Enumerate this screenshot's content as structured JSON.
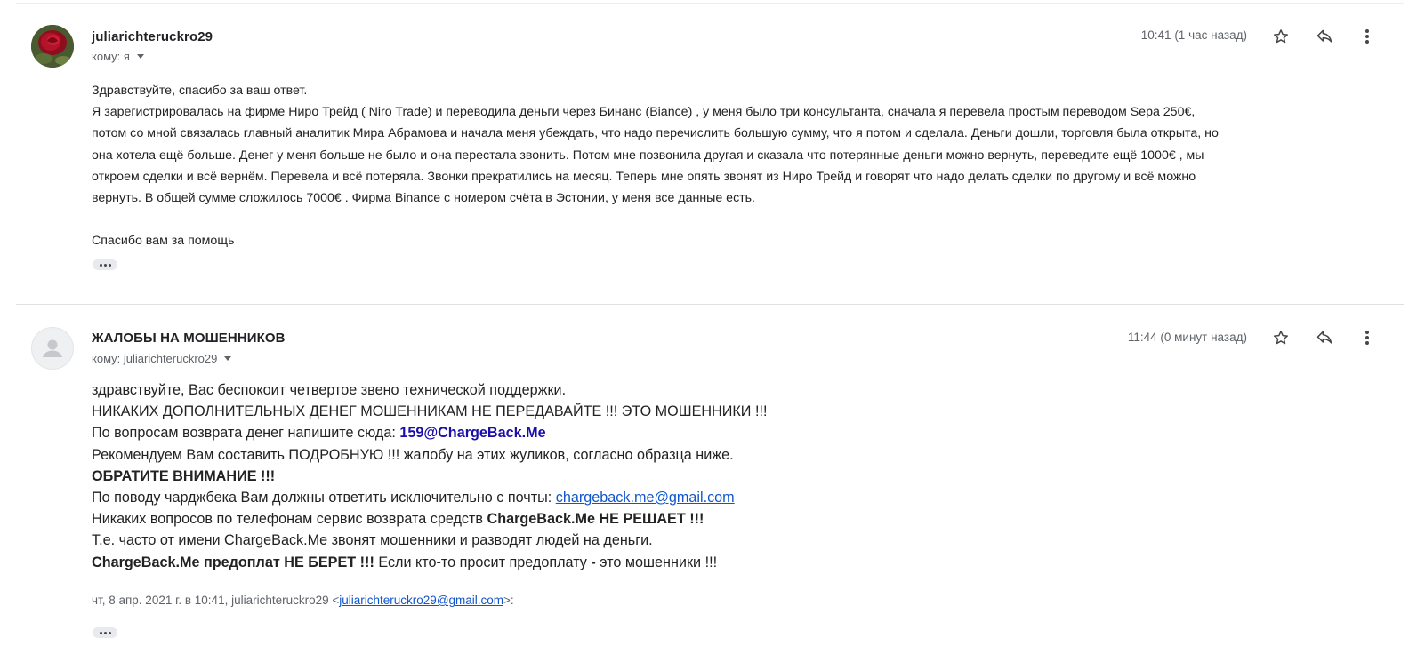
{
  "messages": [
    {
      "sender": "juliarichteruckro29",
      "recipient_line": "кому: я",
      "time": "10:41 (1 час назад)",
      "body_lines": [
        "Здравствуйте, спасибо за ваш ответ.",
        "Я зарегистрировалась на фирме Ниро Трейд ( Niro Trade) и переводила деньги через Бинанс (Biance) , у меня было три консультанта, сначала я перевела простым переводом Sepa 250€,",
        "потом со мной связалась главный аналитик Мира Абрамова и начала меня убеждать, что надо перечислить большую сумму, что я потом и сделала. Деньги дошли, торговля была открыта, но",
        "она хотела ещё больше. Денег у меня больше не было и она перестала звонить. Потом мне позвонила другая и сказала что потерянные деньги можно вернуть, переведите ещё 1000€ , мы",
        "откроем сделки и всё вернём. Перевела и всё потеряла. Звонки прекратились на месяц. Теперь мне опять звонят из Ниро Трейд и говорят что надо делать сделки по другому и всё можно",
        "вернуть. В общей сумме сложилось 7000€ . Фирма Binance с номером счёта в Эстонии, у меня все данные есть."
      ],
      "closing": "Спасибо вам за помощь"
    },
    {
      "sender": "ЖАЛОБЫ НА МОШЕННИКОВ",
      "recipient_line": "кому: juliarichteruckro29",
      "time": "11:44 (0 минут назад)",
      "line1": "здравствуйте, Вас беспокоит четвертое звено технической поддержки.",
      "line2": "НИКАКИХ ДОПОЛНИТЕЛЬНЫХ ДЕНЕГ МОШЕННИКАМ НЕ ПЕРЕДАВАЙТЕ !!! ЭТО МОШЕННИКИ !!!",
      "line3_prefix": "По вопросам возврата денег напишите сюда: ",
      "line3_email": "159@ChargeBack.Me",
      "line4": "Рекомендуем Вам составить ПОДРОБНУЮ !!! жалобу на этих жуликов, согласно образца ниже.",
      "line5": "ОБРАТИТЕ ВНИМАНИЕ !!!",
      "line6_prefix": "По поводу чарджбека Вам должны ответить исключительно с почты: ",
      "line6_link": "chargeback.me@gmail.com",
      "line7_prefix": "Никаких вопросов по телефонам сервис возврата средств ",
      "line7_bold": "ChargeBack.Me НЕ РЕШАЕТ !!!",
      "line8": "Т.е. часто от имени ChargeBack.Me звонят мошенники и разводят людей на деньги.",
      "line9_bold": "ChargeBack.Me предоплат НЕ БЕРЕТ !!!",
      "line9_mid": " Если кто-то просит предоплату ",
      "line9_dash": "-",
      "line9_end": " это мошенники !!!",
      "quote_prefix": "чт, 8 апр. 2021 г. в 10:41, juliarichteruckro29 <",
      "quote_email": "juliarichteruckro29@gmail.com",
      "quote_suffix": ">:"
    }
  ],
  "icons": {
    "star": "star-icon",
    "reply": "reply-icon",
    "more": "more-vert-icon",
    "expand": "show-trimmed-content-icon"
  }
}
